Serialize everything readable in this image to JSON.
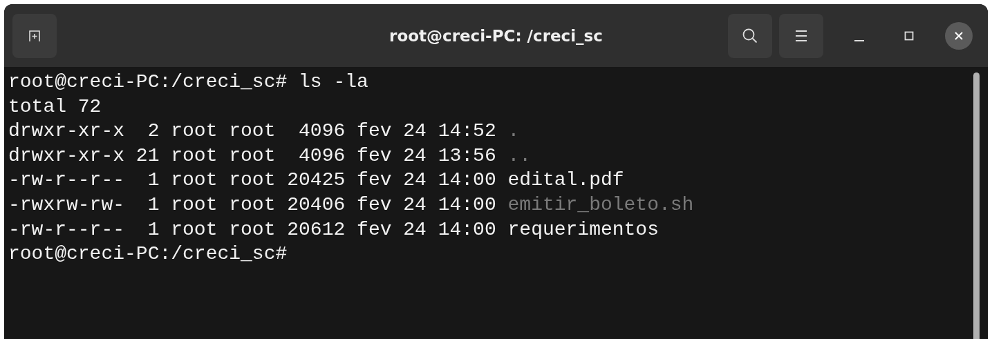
{
  "window": {
    "title": "root@creci-PC: /creci_sc"
  },
  "terminal": {
    "lines": [
      {
        "kind": "text",
        "text": "root@creci-PC:/creci_sc# ls -la"
      },
      {
        "kind": "text",
        "text": "total 72"
      },
      {
        "kind": "entry",
        "info": "drwxr-xr-x  2 root root  4096 fev 24 14:52",
        "name": ".",
        "color": "#7a7a7a"
      },
      {
        "kind": "entry",
        "info": "drwxr-xr-x 21 root root  4096 fev 24 13:56",
        "name": "..",
        "color": "#7a7a7a"
      },
      {
        "kind": "entry",
        "info": "-rw-r--r--  1 root root 20425 fev 24 14:00",
        "name": "edital.pdf",
        "color": "#f2f2f2"
      },
      {
        "kind": "entry",
        "info": "-rwxrw-rw-  1 root root 20406 fev 24 14:00",
        "name": "emitir_boleto.sh",
        "color": "#7a7a7a"
      },
      {
        "kind": "entry",
        "info": "-rw-r--r--  1 root root 20612 fev 24 14:00",
        "name": "requerimentos",
        "color": "#f2f2f2"
      },
      {
        "kind": "text",
        "text": "root@creci-PC:/creci_sc#"
      }
    ]
  }
}
